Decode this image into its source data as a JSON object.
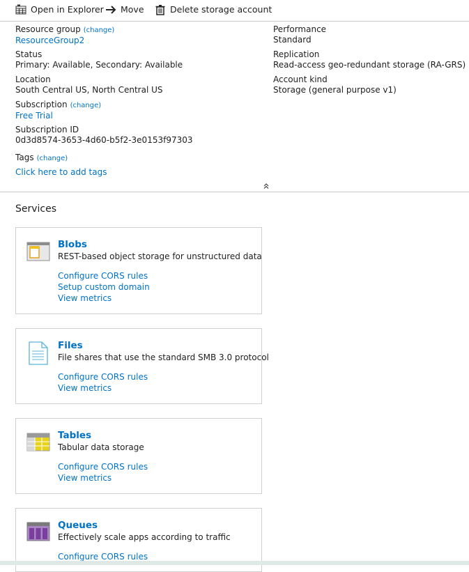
{
  "toolbar": {
    "open_explorer": "Open in Explorer",
    "move": "Move",
    "delete": "Delete storage account"
  },
  "essentials": {
    "resource_group": {
      "label": "Resource group",
      "change": "(change)",
      "value": "ResourceGroup2"
    },
    "status": {
      "label": "Status",
      "value": "Primary: Available, Secondary: Available"
    },
    "location": {
      "label": "Location",
      "value": "South Central US, North Central US"
    },
    "subscription": {
      "label": "Subscription",
      "change": "(change)",
      "value": "Free Trial"
    },
    "subscription_id": {
      "label": "Subscription ID",
      "value": "0d3d8574-3653-4d60-b5f2-3e0153f97303"
    },
    "performance": {
      "label": "Performance",
      "value": "Standard"
    },
    "replication": {
      "label": "Replication",
      "value": "Read-access geo-redundant storage (RA-GRS)"
    },
    "account_kind": {
      "label": "Account kind",
      "value": "Storage (general purpose v1)"
    },
    "tags": {
      "label": "Tags",
      "change": "(change)",
      "add": "Click here to add tags"
    }
  },
  "services": {
    "title": "Services",
    "cards": [
      {
        "icon": "blob-container-icon",
        "title": "Blobs",
        "desc": "REST-based object storage for unstructured data",
        "links": [
          "Configure CORS rules",
          "Setup custom domain",
          "View metrics"
        ]
      },
      {
        "icon": "file-share-icon",
        "title": "Files",
        "desc": "File shares that use the standard SMB 3.0 protocol",
        "links": [
          "Configure CORS rules",
          "View metrics"
        ]
      },
      {
        "icon": "table-icon",
        "title": "Tables",
        "desc": "Tabular data storage",
        "links": [
          "Configure CORS rules",
          "View metrics"
        ]
      },
      {
        "icon": "queue-icon",
        "title": "Queues",
        "desc": "Effectively scale apps according to traffic",
        "links": [
          "Configure CORS rules"
        ]
      }
    ]
  },
  "colors": {
    "link": "#0072c6",
    "divider": "#c8c8c8",
    "table_yellow": "#e8d31c",
    "queue_purple": "#7a3f9d"
  }
}
